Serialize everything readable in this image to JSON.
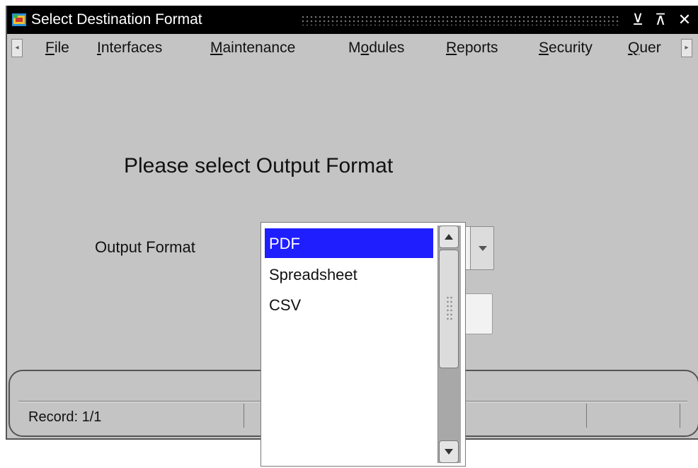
{
  "window": {
    "title": "Select Destination Format"
  },
  "titlebar_icons": {
    "app": "oracle-forms-app-icon",
    "minimize": "minimize-icon",
    "maximize": "maximize-icon",
    "close": "close-icon",
    "minimize_glyph": "⊻",
    "maximize_glyph": "⊼",
    "close_glyph": "✕"
  },
  "menubar": {
    "items": [
      {
        "label": "File",
        "mnemonic": "F"
      },
      {
        "label": "Interfaces",
        "mnemonic": "I"
      },
      {
        "label": "Maintenance",
        "mnemonic": "M"
      },
      {
        "label": "Modules",
        "mnemonic": "o"
      },
      {
        "label": "Reports",
        "mnemonic": "R"
      },
      {
        "label": "Security",
        "mnemonic": "S"
      },
      {
        "label": "Quer",
        "mnemonic": "Q"
      }
    ],
    "scroll_left_glyph": "◂",
    "scroll_right_glyph": "▸"
  },
  "form": {
    "prompt": "Please select Output Format",
    "field_label": "Output Format",
    "selected_value": "PDF"
  },
  "list": {
    "options": [
      "PDF",
      "Spreadsheet",
      "CSV"
    ]
  },
  "status": {
    "record": "Record: 1/1"
  },
  "colors": {
    "titlebar": "#000000",
    "background": "#c4c4c4",
    "selection": "#1e1eff"
  }
}
